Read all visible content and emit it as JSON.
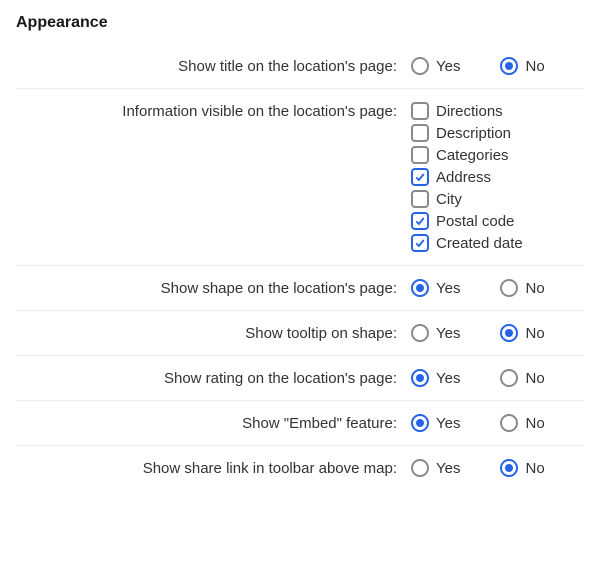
{
  "section_title": "Appearance",
  "yes": "Yes",
  "no": "No",
  "rows": {
    "show_title": {
      "label": "Show title on the location's page:",
      "value": "no"
    },
    "info_visible": {
      "label": "Information visible on the location's page:"
    },
    "show_shape": {
      "label": "Show shape on the location's page:",
      "value": "yes"
    },
    "show_tooltip": {
      "label": "Show tooltip on shape:",
      "value": "no"
    },
    "show_rating": {
      "label": "Show rating on the location's page:",
      "value": "yes"
    },
    "show_embed": {
      "label": "Show \"Embed\" feature:",
      "value": "yes"
    },
    "show_sharelink": {
      "label": "Show share link in toolbar above map:",
      "value": "no"
    }
  },
  "info_options": [
    {
      "label": "Directions",
      "checked": false
    },
    {
      "label": "Description",
      "checked": false
    },
    {
      "label": "Categories",
      "checked": false
    },
    {
      "label": "Address",
      "checked": true
    },
    {
      "label": "City",
      "checked": false
    },
    {
      "label": "Postal code",
      "checked": true
    },
    {
      "label": "Created date",
      "checked": true
    }
  ]
}
